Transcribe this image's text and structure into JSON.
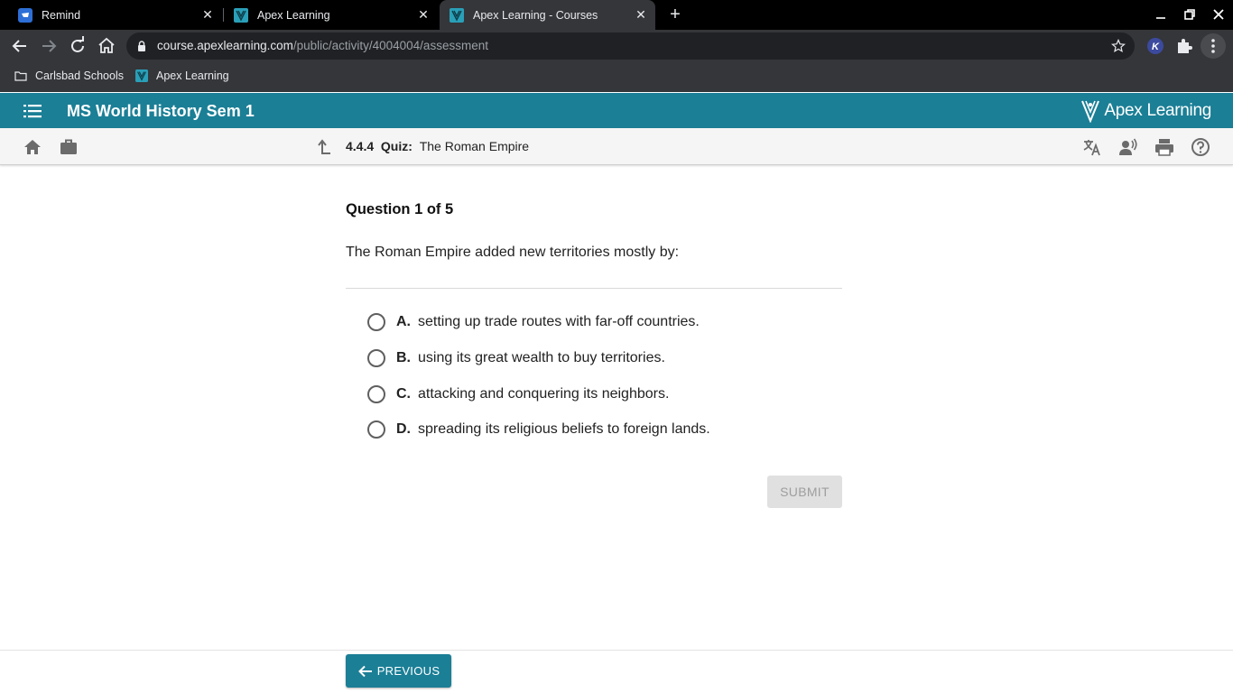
{
  "browser": {
    "tabs": [
      {
        "title": "Remind",
        "icon": "remind-icon"
      },
      {
        "title": "Apex Learning",
        "icon": "apex-favicon"
      },
      {
        "title": "Apex Learning - Courses",
        "icon": "apex-favicon",
        "active": true
      }
    ],
    "url_host": "course.apexlearning.com",
    "url_path": "/public/activity/4004004/assessment",
    "bookmarks": [
      {
        "label": "Carlsbad Schools",
        "icon": "folder-icon"
      },
      {
        "label": "Apex Learning",
        "icon": "apex-favicon"
      }
    ]
  },
  "header": {
    "course_title": "MS World History Sem 1",
    "logo_text": "Apex Learning",
    "brand_color": "#1b7f96"
  },
  "subnav": {
    "number": "4.4.4",
    "type": "Quiz:",
    "title": "The Roman Empire"
  },
  "quiz": {
    "question_header": "Question 1 of 5",
    "question_text": "The Roman Empire added new territories mostly by:",
    "choices": [
      {
        "letter": "A.",
        "text": "setting up trade routes with far-off countries."
      },
      {
        "letter": "B.",
        "text": "using its great wealth to buy territories."
      },
      {
        "letter": "C.",
        "text": "attacking and conquering its neighbors."
      },
      {
        "letter": "D.",
        "text": "spreading its religious beliefs to foreign lands."
      }
    ],
    "submit_label": "SUBMIT"
  },
  "footer": {
    "previous_label": "PREVIOUS"
  }
}
